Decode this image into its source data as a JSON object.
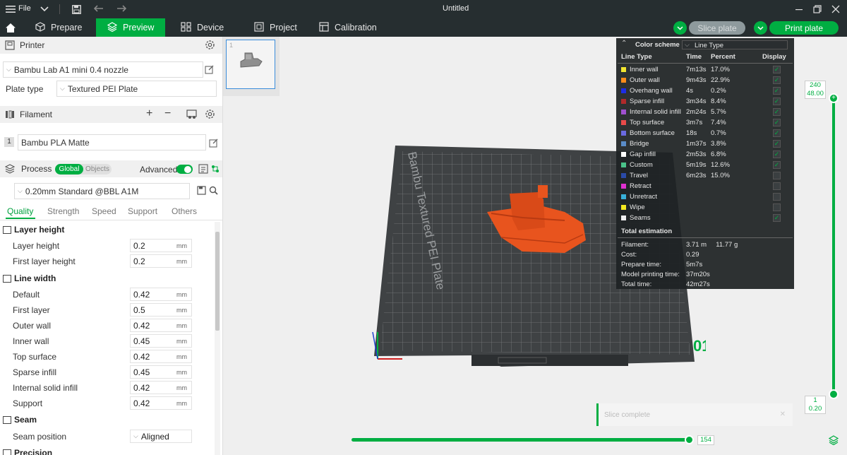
{
  "title_bar": {
    "file_label": "File",
    "window_title": "Untitled"
  },
  "nav": {
    "tabs": [
      {
        "label": "Prepare",
        "icon": "cube-icon"
      },
      {
        "label": "Preview",
        "icon": "layers-icon",
        "active": true
      },
      {
        "label": "Device",
        "icon": "device-icon"
      },
      {
        "label": "Project",
        "icon": "project-icon"
      },
      {
        "label": "Calibration",
        "icon": "calibration-icon"
      }
    ],
    "slice_plate": "Slice plate",
    "print_plate": "Print plate"
  },
  "sidebar": {
    "printer_header": "Printer",
    "printer_value": "Bambu Lab A1 mini 0.4 nozzle",
    "plate_type_label": "Plate type",
    "plate_type_value": "Textured PEI Plate",
    "filament_header": "Filament",
    "filament_index": "1",
    "filament_value": "Bambu PLA Matte",
    "process_header": "Process",
    "process_toggle": {
      "global": "Global",
      "objects": "Objects"
    },
    "advanced_label": "Advanced",
    "process_preset": "0.20mm Standard @BBL A1M",
    "tabs": [
      "Quality",
      "Strength",
      "Speed",
      "Support",
      "Others"
    ],
    "groups": {
      "layer_height": {
        "title": "Layer height",
        "rows": [
          {
            "label": "Layer height",
            "value": "0.2",
            "unit": "mm"
          },
          {
            "label": "First layer height",
            "value": "0.2",
            "unit": "mm"
          }
        ]
      },
      "line_width": {
        "title": "Line width",
        "rows": [
          {
            "label": "Default",
            "value": "0.42",
            "unit": "mm"
          },
          {
            "label": "First layer",
            "value": "0.5",
            "unit": "mm"
          },
          {
            "label": "Outer wall",
            "value": "0.42",
            "unit": "mm"
          },
          {
            "label": "Inner wall",
            "value": "0.45",
            "unit": "mm"
          },
          {
            "label": "Top surface",
            "value": "0.42",
            "unit": "mm"
          },
          {
            "label": "Sparse infill",
            "value": "0.45",
            "unit": "mm"
          },
          {
            "label": "Internal solid infill",
            "value": "0.42",
            "unit": "mm"
          },
          {
            "label": "Support",
            "value": "0.42",
            "unit": "mm"
          }
        ]
      },
      "seam": {
        "title": "Seam",
        "rows": [
          {
            "label": "Seam position",
            "value": "Aligned"
          }
        ]
      },
      "precision": {
        "title": "Precision"
      }
    }
  },
  "viewport": {
    "thumb_index": "1",
    "plate_text": "Bambu Textured PEI Plate",
    "plate_number": "01",
    "layer_top": "240",
    "height_top": "48.00",
    "layer_bottom": "1",
    "height_bottom": "0.20",
    "horizontal_value": "154",
    "toast": "Slice complete"
  },
  "stats": {
    "color_scheme_label": "Color scheme",
    "color_scheme_value": "Line Type",
    "headers": {
      "type": "Line Type",
      "time": "Time",
      "percent": "Percent",
      "display": "Display"
    },
    "rows": [
      {
        "name": "Inner wall",
        "color": "#f2e530",
        "time": "7m13s",
        "percent": "17.0%",
        "display": true
      },
      {
        "name": "Outer wall",
        "color": "#ff8c1a",
        "time": "9m43s",
        "percent": "22.9%",
        "display": true
      },
      {
        "name": "Overhang wall",
        "color": "#1d2de6",
        "time": "4s",
        "percent": "0.2%",
        "display": true
      },
      {
        "name": "Sparse infill",
        "color": "#b02a2a",
        "time": "3m34s",
        "percent": "8.4%",
        "display": true
      },
      {
        "name": "Internal solid infill",
        "color": "#a050d0",
        "time": "2m24s",
        "percent": "5.7%",
        "display": true
      },
      {
        "name": "Top surface",
        "color": "#e84a4a",
        "time": "3m7s",
        "percent": "7.4%",
        "display": true
      },
      {
        "name": "Bottom surface",
        "color": "#6a6ae0",
        "time": "18s",
        "percent": "0.7%",
        "display": true
      },
      {
        "name": "Bridge",
        "color": "#5a8cc8",
        "time": "1m37s",
        "percent": "3.8%",
        "display": true
      },
      {
        "name": "Gap infill",
        "color": "#ffffff",
        "time": "2m53s",
        "percent": "6.8%",
        "display": true
      },
      {
        "name": "Custom",
        "color": "#4ac28a",
        "time": "5m19s",
        "percent": "12.6%",
        "display": true
      },
      {
        "name": "Travel",
        "color": "#2a4aa8",
        "time": "6m23s",
        "percent": "15.0%",
        "display": false
      },
      {
        "name": "Retract",
        "color": "#e030d0",
        "time": "",
        "percent": "",
        "display": false
      },
      {
        "name": "Unretract",
        "color": "#38b0d8",
        "time": "",
        "percent": "",
        "display": false
      },
      {
        "name": "Wipe",
        "color": "#f5e820",
        "time": "",
        "percent": "",
        "display": false
      },
      {
        "name": "Seams",
        "color": "#f0f0f0",
        "time": "",
        "percent": "",
        "display": true
      }
    ],
    "total_header": "Total estimation",
    "estimation": [
      {
        "label": "Filament:",
        "value": "3.71 m     11.77 g"
      },
      {
        "label": "Cost:",
        "value": "0.29"
      },
      {
        "label": "Prepare time:",
        "value": "5m7s"
      },
      {
        "label": "Model printing time:",
        "value": "37m20s"
      },
      {
        "label": "Total time:",
        "value": "42m27s"
      }
    ]
  },
  "colors": {
    "accent": "#00ae42",
    "dark_bar": "#262e30",
    "plate": "#3f4244",
    "model": "#e8541e"
  }
}
